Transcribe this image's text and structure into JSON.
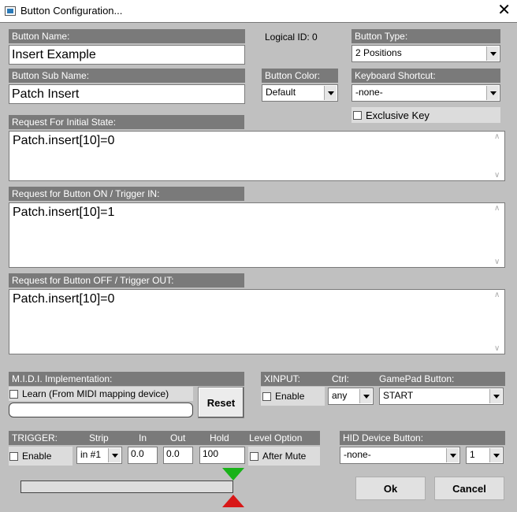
{
  "window": {
    "title": "Button Configuration..."
  },
  "button_name": {
    "label": "Button Name:",
    "value": "Insert Example"
  },
  "logical_id": "Logical ID: 0",
  "button_type": {
    "label": "Button Type:",
    "value": "2 Positions"
  },
  "button_sub_name": {
    "label": "Button Sub Name:",
    "value": "Patch Insert"
  },
  "button_color": {
    "label": "Button Color:",
    "value": "Default"
  },
  "keyboard_shortcut": {
    "label": "Keyboard Shortcut:",
    "value": "-none-"
  },
  "exclusive_key": {
    "label": "Exclusive Key",
    "checked": false
  },
  "request_initial": {
    "label": "Request For Initial State:",
    "value": "Patch.insert[10]=0"
  },
  "request_on": {
    "label": "Request for Button ON / Trigger IN:",
    "value": "Patch.insert[10]=1"
  },
  "request_off": {
    "label": "Request for Button OFF / Trigger OUT:",
    "value": "Patch.insert[10]=0"
  },
  "midi": {
    "label": "M.I.D.I. Implementation:",
    "learn_label": "Learn (From MIDI mapping device)",
    "learn_checked": false,
    "reset_label": "Reset"
  },
  "xinput": {
    "label": "XINPUT:",
    "ctrl_label": "Ctrl:",
    "gamepad_label": "GamePad Button:",
    "enable_label": "Enable",
    "enable_checked": false,
    "ctrl_value": "any",
    "gamepad_value": "START"
  },
  "trigger": {
    "label": "TRIGGER:",
    "strip_label": "Strip",
    "in_label": "In",
    "out_label": "Out",
    "hold_label": "Hold",
    "level_label": "Level Option",
    "enable_label": "Enable",
    "enable_checked": false,
    "strip_value": "in #1",
    "in_value": "0.0",
    "out_value": "0.0",
    "hold_value": "100",
    "after_mute_label": "After Mute",
    "after_mute_checked": false
  },
  "hid": {
    "label": "HID Device Button:",
    "device_value": "-none-",
    "number_value": "1"
  },
  "footer": {
    "ok_label": "Ok",
    "cancel_label": "Cancel"
  },
  "colors": {
    "label_bg": "#7a7a7a",
    "window_bg": "#c0c0c0",
    "trigger_in": "#19b219",
    "trigger_out": "#d81717"
  }
}
